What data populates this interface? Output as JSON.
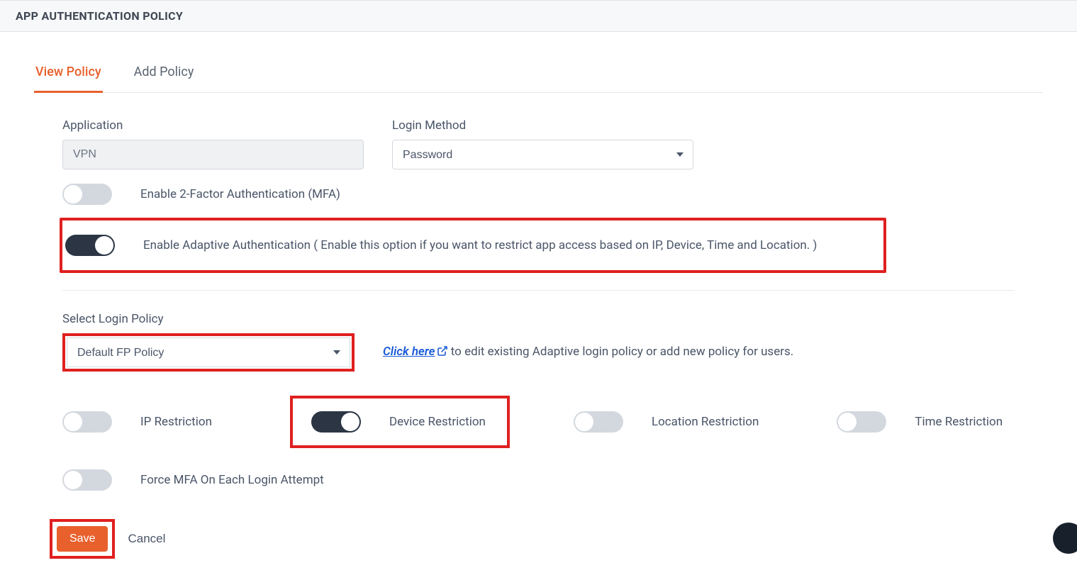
{
  "header": {
    "title": "APP AUTHENTICATION POLICY"
  },
  "tabs": {
    "view": "View Policy",
    "add": "Add Policy"
  },
  "form": {
    "application_label": "Application",
    "application_value": "VPN",
    "login_method_label": "Login Method",
    "login_method_value": "Password",
    "mfa_toggle_label": "Enable 2-Factor Authentication (MFA)",
    "adaptive_toggle_label": "Enable Adaptive Authentication ( Enable this option if you want to restrict app access based on IP, Device, Time and Location. )"
  },
  "policy": {
    "select_label": "Select Login Policy",
    "select_value": "Default FP Policy",
    "link_text": "Click here",
    "help_text": " to edit existing Adaptive login policy or add new policy for users."
  },
  "restrictions": {
    "ip": "IP Restriction",
    "device": "Device Restriction",
    "location": "Location Restriction",
    "time": "Time Restriction",
    "force_mfa": "Force MFA On Each Login Attempt"
  },
  "buttons": {
    "save": "Save",
    "cancel": "Cancel"
  }
}
